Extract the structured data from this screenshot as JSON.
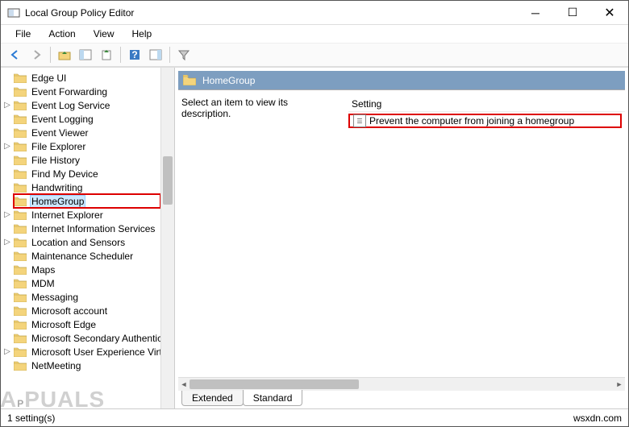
{
  "window": {
    "title": "Local Group Policy Editor"
  },
  "menubar": [
    "File",
    "Action",
    "View",
    "Help"
  ],
  "toolbar_icons": [
    "back-arrow-icon",
    "forward-arrow-icon",
    "up-folder-icon",
    "show-hide-tree-icon",
    "export-icon",
    "help-icon",
    "show-hide-actions-icon",
    "filter-icon"
  ],
  "tree": {
    "items": [
      {
        "label": "Edge UI",
        "expandable": false
      },
      {
        "label": "Event Forwarding",
        "expandable": false
      },
      {
        "label": "Event Log Service",
        "expandable": true
      },
      {
        "label": "Event Logging",
        "expandable": false
      },
      {
        "label": "Event Viewer",
        "expandable": false
      },
      {
        "label": "File Explorer",
        "expandable": true
      },
      {
        "label": "File History",
        "expandable": false
      },
      {
        "label": "Find My Device",
        "expandable": false
      },
      {
        "label": "Handwriting",
        "expandable": false
      },
      {
        "label": "HomeGroup",
        "expandable": false,
        "selected": true,
        "highlighted": true
      },
      {
        "label": "Internet Explorer",
        "expandable": true
      },
      {
        "label": "Internet Information Services",
        "expandable": false
      },
      {
        "label": "Location and Sensors",
        "expandable": true
      },
      {
        "label": "Maintenance Scheduler",
        "expandable": false
      },
      {
        "label": "Maps",
        "expandable": false
      },
      {
        "label": "MDM",
        "expandable": false
      },
      {
        "label": "Messaging",
        "expandable": false
      },
      {
        "label": "Microsoft account",
        "expandable": false
      },
      {
        "label": "Microsoft Edge",
        "expandable": false
      },
      {
        "label": "Microsoft Secondary Authentication",
        "expandable": false
      },
      {
        "label": "Microsoft User Experience Virtualization",
        "expandable": true
      },
      {
        "label": "NetMeeting",
        "expandable": false
      }
    ]
  },
  "right": {
    "header_title": "HomeGroup",
    "description_prompt": "Select an item to view its description.",
    "column_header": "Setting",
    "settings": [
      {
        "label": "Prevent the computer from joining a homegroup",
        "highlighted": true
      }
    ]
  },
  "tabs": {
    "extended": "Extended",
    "standard": "Standard",
    "active": "standard"
  },
  "statusbar": {
    "left": "1 setting(s)",
    "right": "wsxdn.com"
  },
  "watermark": "APPUALS"
}
